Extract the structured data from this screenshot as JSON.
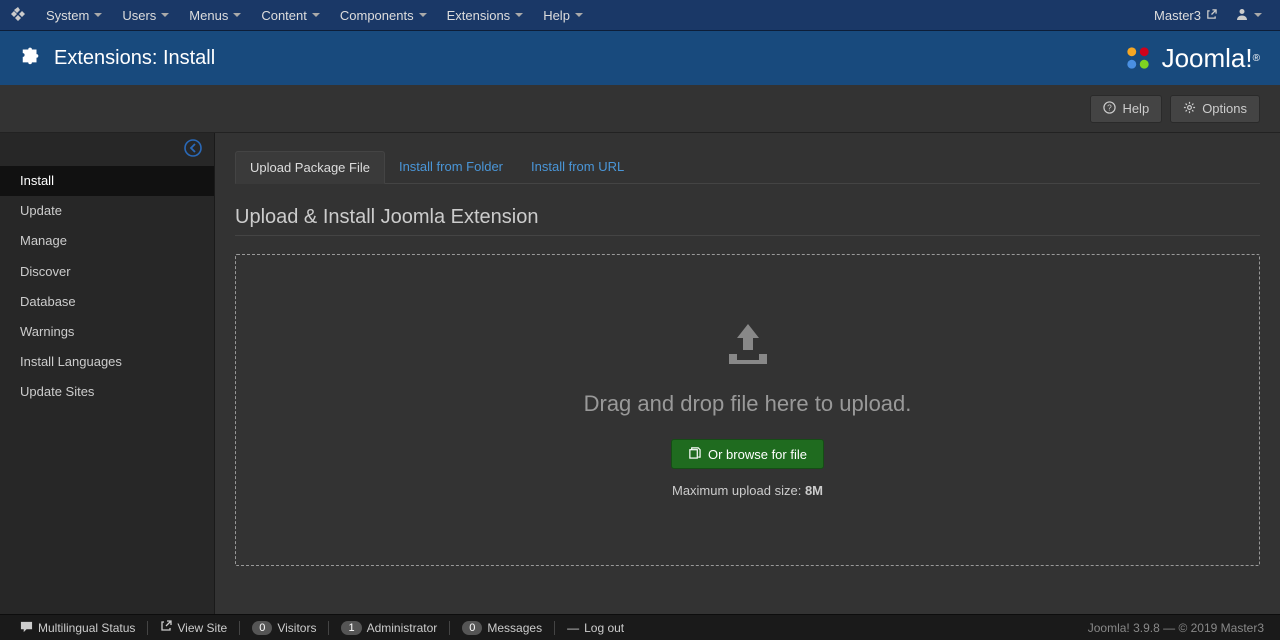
{
  "navbar": {
    "menus": [
      "System",
      "Users",
      "Menus",
      "Content",
      "Components",
      "Extensions",
      "Help"
    ],
    "site_name": "Master3"
  },
  "header": {
    "title": "Extensions: Install",
    "brand": "Joomla!"
  },
  "toolbar": {
    "help": "Help",
    "options": "Options"
  },
  "sidebar": {
    "items": [
      "Install",
      "Update",
      "Manage",
      "Discover",
      "Database",
      "Warnings",
      "Install Languages",
      "Update Sites"
    ],
    "active_index": 0
  },
  "tabs": {
    "items": [
      "Upload Package File",
      "Install from Folder",
      "Install from URL"
    ],
    "active_index": 0
  },
  "content": {
    "heading": "Upload & Install Joomla Extension",
    "drag_text": "Drag and drop file here to upload.",
    "browse_label": "Or browse for file",
    "max_size_label": "Maximum upload size: ",
    "max_size_value": "8M"
  },
  "footer": {
    "multilingual": "Multilingual Status",
    "view_site": "View Site",
    "visitors_count": "0",
    "visitors": "Visitors",
    "admin_count": "1",
    "admin": "Administrator",
    "msg_count": "0",
    "msg": "Messages",
    "logout": "Log out",
    "version": "Joomla! 3.9.8",
    "dash": " — ",
    "copyright": "© 2019 Master3"
  }
}
